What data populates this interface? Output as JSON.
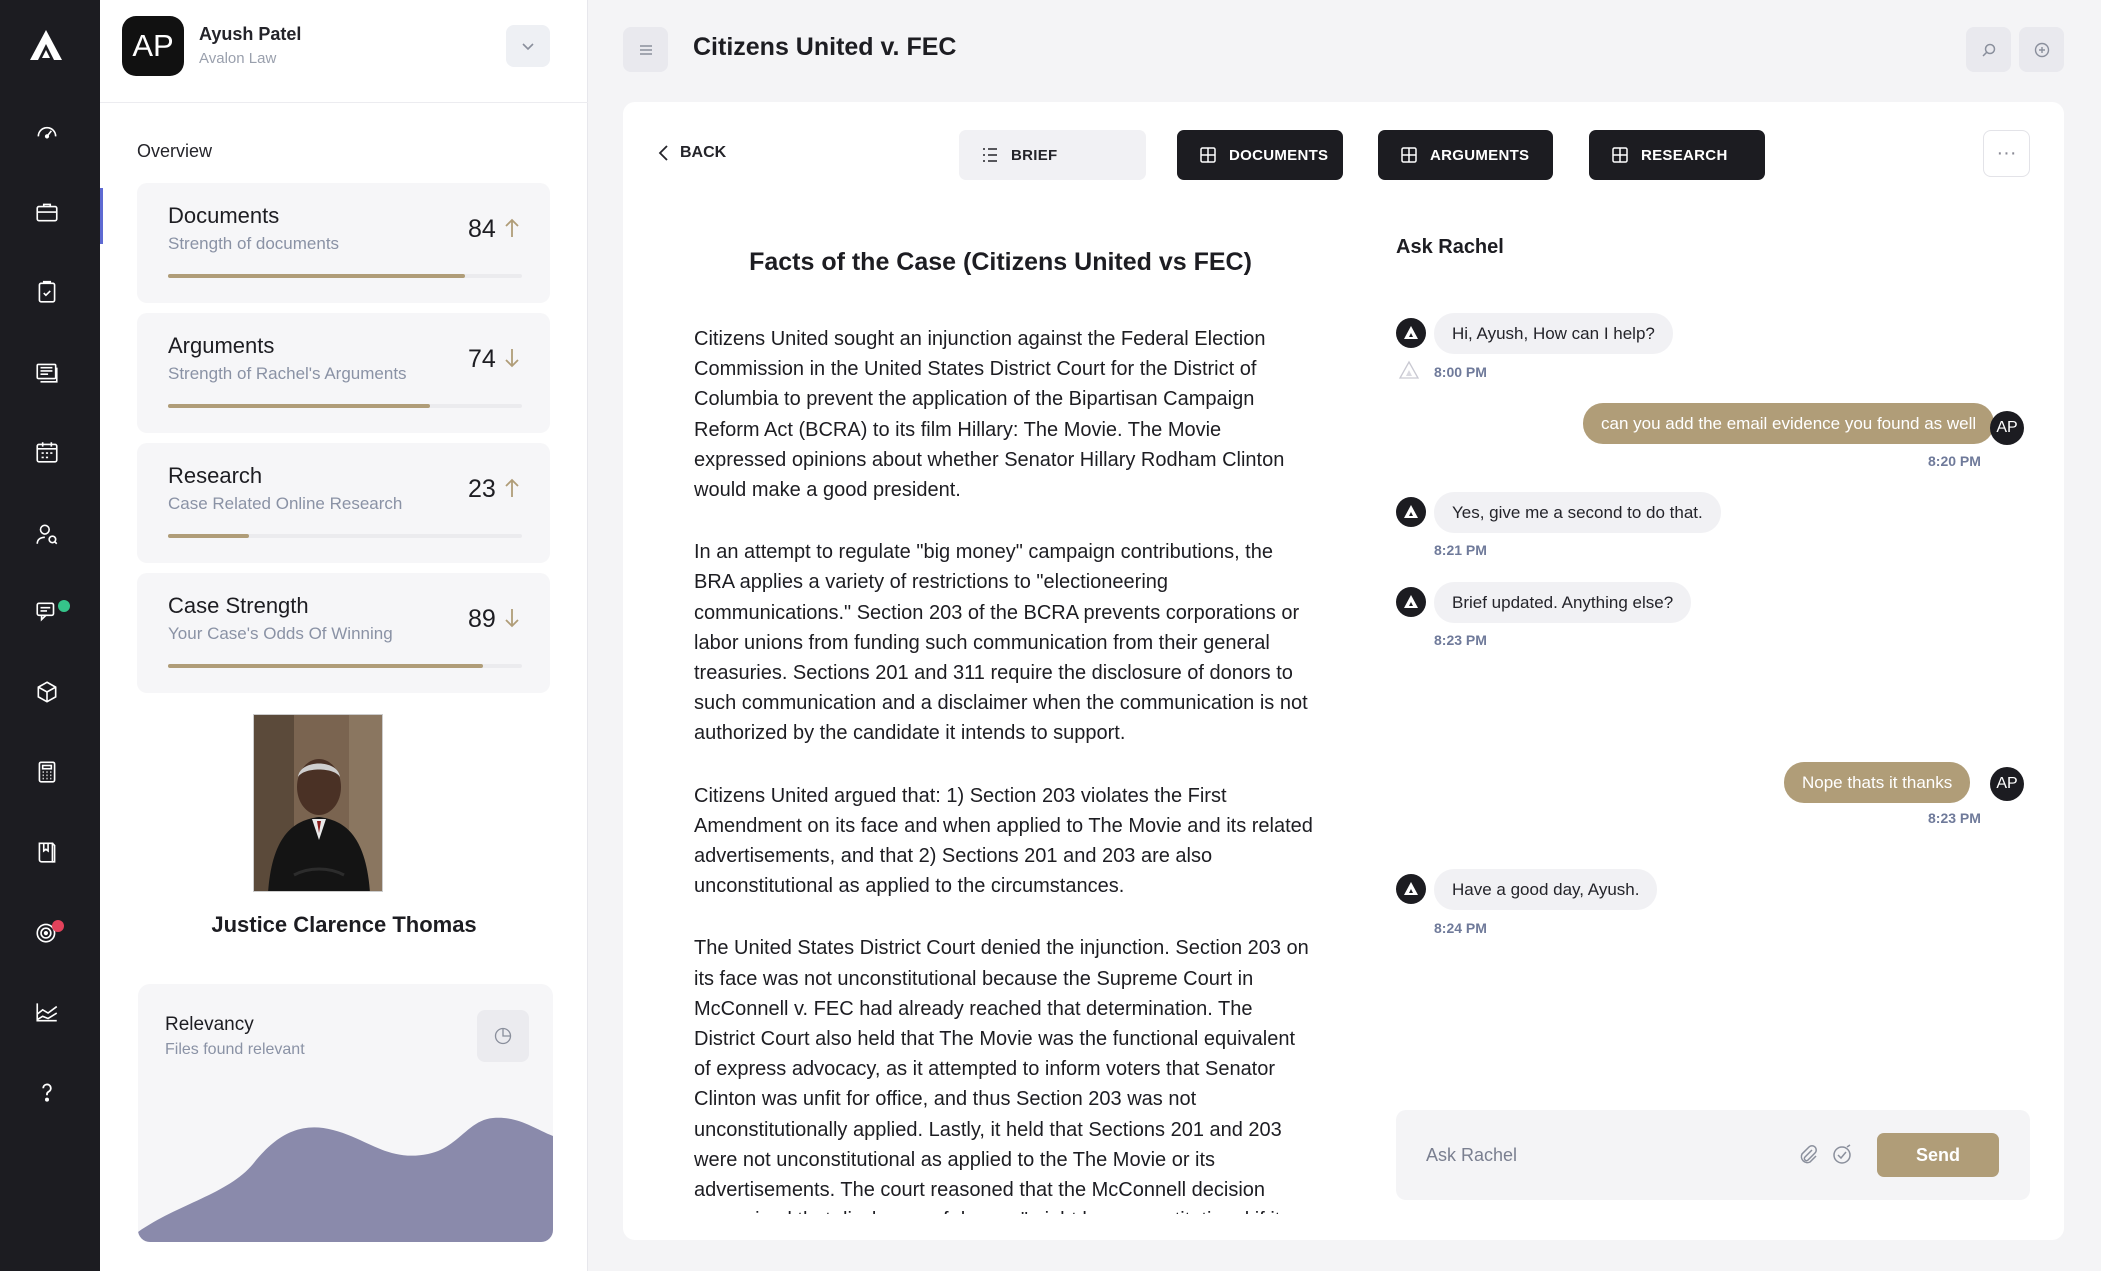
{
  "colors": {
    "accent": "#b09d78",
    "rail": "#1c1c21",
    "progress_track": "#ebebee",
    "chart_fill": "#8a8aab",
    "notification_green": "#35c48a",
    "notification_red": "#e3425b"
  },
  "rail": {
    "logo": "avalon-logo-icon",
    "items": [
      "dashboard-icon",
      "briefcase-icon",
      "clipboard-icon",
      "documents-icon",
      "calendar-icon",
      "users-icon",
      "chat-icon",
      "package-icon",
      "calculator-icon",
      "book-icon",
      "target-icon",
      "chart-icon",
      "help-icon"
    ]
  },
  "profile": {
    "initials": "AP",
    "name": "Ayush Patel",
    "org": "Avalon Law"
  },
  "overview_label": "Overview",
  "cards": [
    {
      "title": "Documents",
      "subtitle": "Strength of documents",
      "value": "84",
      "trend": "up",
      "progress": 0.84
    },
    {
      "title": "Arguments",
      "subtitle": "Strength of Rachel's Arguments",
      "value": "74",
      "trend": "down",
      "progress": 0.74
    },
    {
      "title": "Research",
      "subtitle": "Case Related Online Research",
      "value": "23",
      "trend": "up",
      "progress": 0.23
    },
    {
      "title": "Case Strength",
      "subtitle": "Your Case's Odds Of Winning",
      "value": "89",
      "trend": "down",
      "progress": 0.89
    }
  ],
  "judge": {
    "name": "Justice Clarence Thomas"
  },
  "relevancy": {
    "title": "Relevancy",
    "subtitle": "Files found relevant"
  },
  "header": {
    "title": "Citizens United v. FEC"
  },
  "nav": {
    "back": "BACK",
    "tabs": [
      {
        "label": "BRIEF",
        "icon": "list-icon"
      },
      {
        "label": "DOCUMENTS",
        "icon": "grid-icon"
      },
      {
        "label": "ARGUMENTS",
        "icon": "grid-icon"
      },
      {
        "label": "RESEARCH",
        "icon": "grid-icon"
      }
    ],
    "more": "···"
  },
  "document": {
    "title": "Facts of the Case (Citizens United vs FEC)",
    "paragraphs": [
      "Citizens United sought an injunction against the Federal Election Commission in the United States District Court for the District of Columbia to prevent the application of the Bipartisan Campaign Reform Act (BCRA) to its film Hillary: The Movie. The Movie expressed opinions about whether Senator Hillary Rodham Clinton would make a good president.",
      "In an attempt to regulate \"big money\" campaign contributions, the BRA applies a variety of restrictions to \"electioneering communications.\" Section 203 of the BCRA prevents corporations or labor unions from funding such communication from their general treasuries. Sections 201 and 311 require the disclosure of donors to such communication and a disclaimer when the communication is not authorized by the candidate it intends to support.",
      "Citizens United argued that:  1) Section 203 violates the First Amendment on its face and when applied to The Movie and its related advertisements, and that  2) Sections 201 and 203 are also unconstitutional as applied to the circumstances.",
      "The United States District Court denied the injunction. Section 203 on its face was not unconstitutional because the Supreme Court in McConnell v. FEC had already reached that determination. The District Court also held that The Movie was the functional equivalent of express advocacy, as it attempted to inform voters that Senator Clinton was unfit for office, and thus Section 203 was not unconstitutionally applied. Lastly, it held that Sections 201 and 203 were not unconstitutional as applied to the The Movie or its advertisements. The court reasoned that the McConnell decision recognized that disclosure of donors \"might be unconstitutional if it"
    ]
  },
  "chat": {
    "title": "Ask Rachel",
    "messages": [
      {
        "from": "bot",
        "text": "Hi, Ayush, How can I help?",
        "time": "8:00 PM"
      },
      {
        "from": "user",
        "initials": "AP",
        "text": "can you add the email evidence you found as well",
        "time": "8:20 PM"
      },
      {
        "from": "bot",
        "text": "Yes, give me a second to do that.",
        "time": "8:21 PM"
      },
      {
        "from": "bot",
        "text": "Brief updated. Anything else?",
        "time": "8:23 PM"
      },
      {
        "from": "user",
        "initials": "AP",
        "text": "Nope thats it thanks",
        "time": "8:23 PM"
      },
      {
        "from": "bot",
        "text": "Have a good day, Ayush.",
        "time": "8:24 PM"
      }
    ],
    "input_placeholder": "Ask Rachel",
    "send_label": "Send"
  }
}
